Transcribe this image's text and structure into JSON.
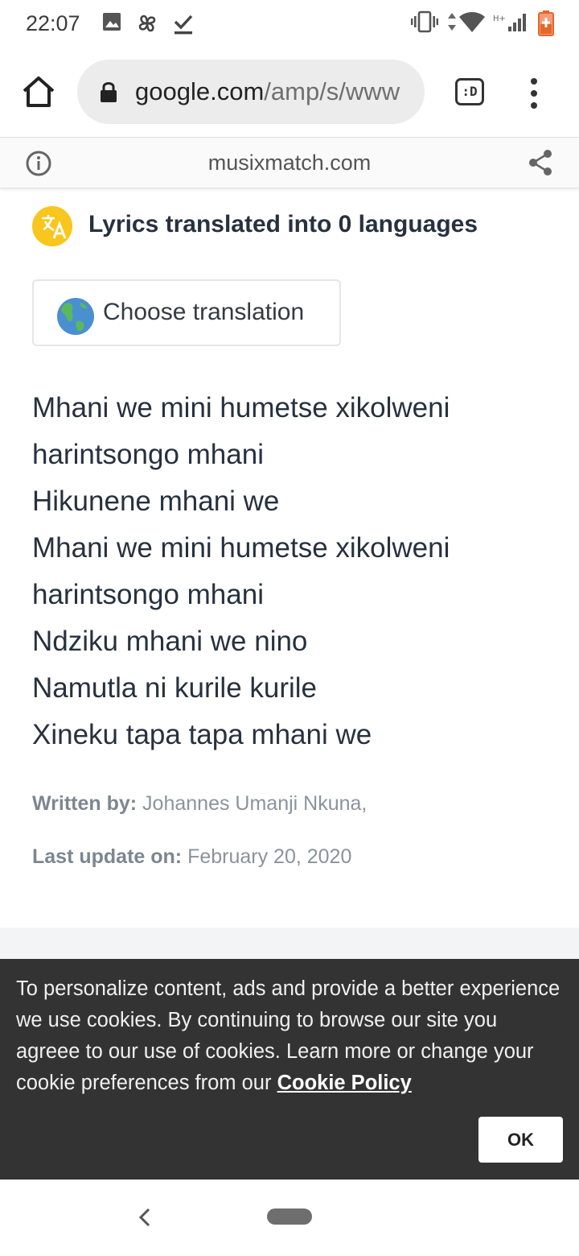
{
  "status_bar": {
    "time": "22:07",
    "left_icons": [
      "image-icon",
      "pinwheel-icon",
      "download-done-icon"
    ],
    "right_icons": [
      "vibrate-icon",
      "data-arrows-icon",
      "wifi-icon",
      "hplus-signal-icon",
      "battery-icon"
    ],
    "network_label": "H+"
  },
  "browser": {
    "url_host": "google.com",
    "url_path": "/amp/s/www",
    "tab_label": ":D"
  },
  "amp_header": {
    "domain": "musixmatch.com"
  },
  "content": {
    "translations_title": "Lyrics translated into 0 languages",
    "choose_translation": "Choose translation",
    "lyrics": [
      "Mhani we mini humetse xikolweni",
      "harintsongo mhani",
      "Hikunene mhani we",
      "Mhani we mini humetse xikolweni",
      "harintsongo mhani",
      "Ndziku mhani we nino",
      "Namutla ni kurile kurile",
      "Xineku tapa tapa mhani we"
    ],
    "written_by_label": "Written by:",
    "written_by_value": "Johannes Umanji Nkuna,",
    "last_update_label": "Last update on:",
    "last_update_value": "February 20, 2020"
  },
  "cookie_banner": {
    "text": "To personalize content, ads and provide a better experience we use cookies. By continuing to browse our site you agreee to our use of cookies. Learn more or change your cookie preferences from our ",
    "link_text": "Cookie Policy",
    "ok_label": "OK"
  },
  "colors": {
    "accent_badge": "#f8c61c",
    "cookie_bg": "#333333",
    "text_dark": "#27313f",
    "meta_gray": "#8a939c"
  }
}
